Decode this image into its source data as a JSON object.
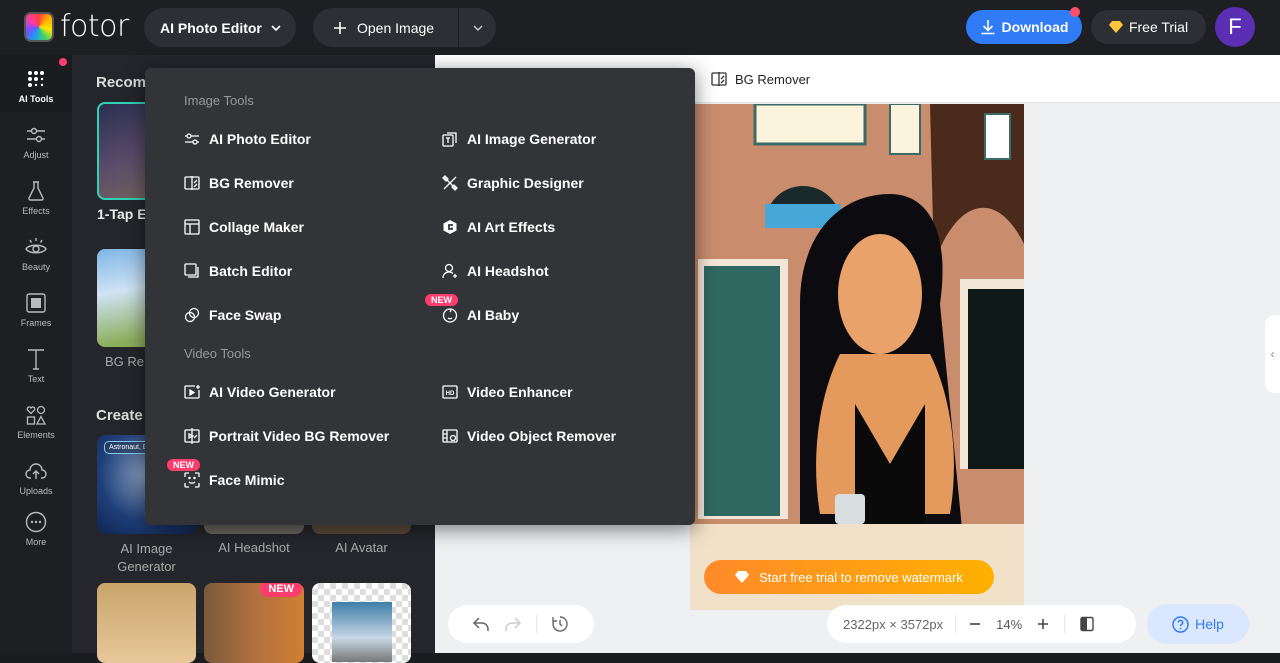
{
  "topbar": {
    "logo_text": "fotor",
    "editor_menu_label": "AI Photo Editor",
    "open_image_label": "Open Image",
    "download_label": "Download",
    "free_trial_label": "Free Trial",
    "avatar_initial": "F"
  },
  "rail": {
    "items": [
      {
        "label": "AI Tools",
        "icon": "grid-dots-icon"
      },
      {
        "label": "Adjust",
        "icon": "sliders-icon"
      },
      {
        "label": "Effects",
        "icon": "flask-icon"
      },
      {
        "label": "Beauty",
        "icon": "eye-icon"
      },
      {
        "label": "Frames",
        "icon": "frame-icon"
      },
      {
        "label": "Text",
        "icon": "text-icon"
      },
      {
        "label": "Elements",
        "icon": "shapes-icon"
      },
      {
        "label": "Uploads",
        "icon": "cloud-upload-icon"
      },
      {
        "label": "More",
        "icon": "more-icon"
      }
    ]
  },
  "panel": {
    "recommended_heading": "Recom",
    "create_heading": "Create",
    "recommended": [
      {
        "label": "1-Tap E"
      },
      {
        "label": "BG Re"
      }
    ],
    "create": [
      {
        "label": "AI Image Generator",
        "thumb_text": "Astronaut, Dr"
      },
      {
        "label": "AI Headshot"
      },
      {
        "label": "AI Avatar"
      }
    ],
    "more_thumbs": [
      {
        "label": ""
      },
      {
        "label": "",
        "badge": "NEW"
      },
      {
        "label": ""
      }
    ]
  },
  "menu": {
    "image_tools_heading": "Image Tools",
    "video_tools_heading": "Video Tools",
    "image_tools": [
      {
        "label": "AI Photo Editor",
        "icon": "sliders-icon"
      },
      {
        "label": "AI Image Generator",
        "icon": "image-generator-icon"
      },
      {
        "label": "BG Remover",
        "icon": "bg-remover-icon"
      },
      {
        "label": "Graphic Designer",
        "icon": "design-tools-icon"
      },
      {
        "label": "Collage Maker",
        "icon": "collage-icon"
      },
      {
        "label": "AI Art Effects",
        "icon": "art-effects-icon"
      },
      {
        "label": "Batch Editor",
        "icon": "batch-icon"
      },
      {
        "label": "AI Headshot",
        "icon": "person-icon"
      },
      {
        "label": "Face Swap",
        "icon": "face-swap-icon"
      },
      {
        "label": "AI Baby",
        "icon": "baby-icon",
        "badge": "NEW"
      }
    ],
    "video_tools": [
      {
        "label": "AI Video Generator",
        "icon": "video-generator-icon"
      },
      {
        "label": "Video Enhancer",
        "icon": "hd-icon"
      },
      {
        "label": "Portrait Video BG Remover",
        "icon": "video-bg-remover-icon"
      },
      {
        "label": "Video Object Remover",
        "icon": "video-object-icon"
      },
      {
        "label": "Face Mimic",
        "icon": "face-scan-icon",
        "badge": "NEW"
      }
    ]
  },
  "canvas": {
    "active_tool": "BG Remover",
    "watermark_cta": "Start free trial to remove watermark",
    "dimensions": "2322px × 3572px",
    "zoom": "14%",
    "help_label": "Help"
  }
}
